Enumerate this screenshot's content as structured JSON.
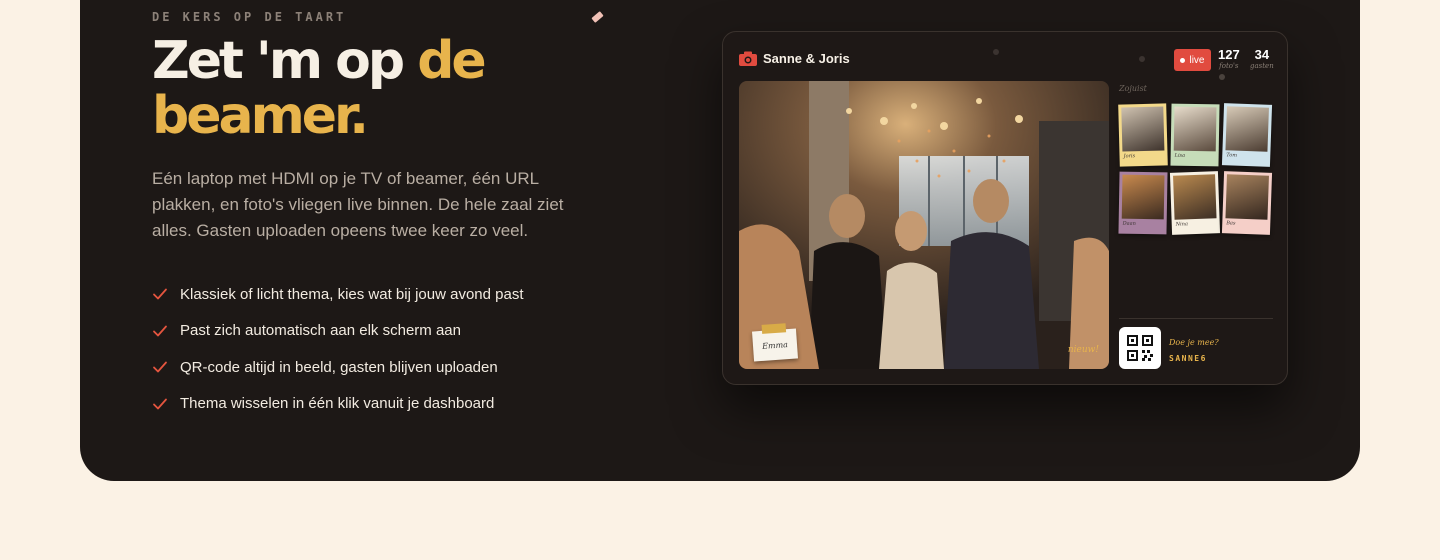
{
  "section": {
    "eyebrow": "DE KERS OP DE TAART",
    "headline_white": "Zet 'm op ",
    "headline_accent": "de beamer.",
    "lead": "Eén laptop met HDMI op je TV of beamer, één URL plakken, en foto's vliegen live binnen. De hele zaal ziet alles. Gasten uploaden opeens twee keer zo veel.",
    "features": [
      "Klassiek of licht thema, kies wat bij jouw avond past",
      "Past zich automatisch aan elk scherm aan",
      "QR-code altijd in beeld, gasten blijven uploaden",
      "Thema wisselen in één klik vanuit je dashboard"
    ]
  },
  "preview": {
    "event_name": "Sanne & Joris",
    "live_label": "live",
    "photos_count": "127",
    "photos_label": "foto's",
    "guests_count": "34",
    "guests_label": "gasten",
    "featured_uploader": "Emma",
    "new_label": "nieuw!",
    "latest_label": "Zojuist",
    "thumbnails": [
      {
        "name": "Joris"
      },
      {
        "name": "Lisa"
      },
      {
        "name": "Tom"
      },
      {
        "name": "Daan"
      },
      {
        "name": "Nina"
      },
      {
        "name": "Bas"
      }
    ],
    "join_question": "Doe je mee?",
    "join_code": "SANNE6"
  },
  "colors": {
    "accent": "#e8b44c",
    "live": "#e14b3f",
    "check": "#e5553f",
    "panel": "#1d1816",
    "page": "#fbf2e5"
  }
}
